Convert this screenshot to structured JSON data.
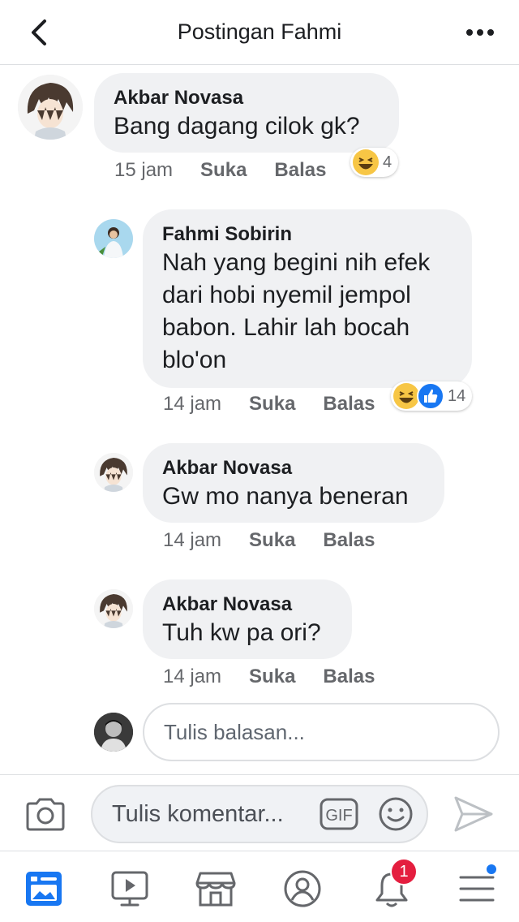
{
  "header": {
    "title": "Postingan Fahmi",
    "back_icon": "chevron-left-icon",
    "more_icon": "ellipsis-icon"
  },
  "comments": [
    {
      "author": "Akbar Novasa",
      "text": "Bang dagang cilok gk?",
      "time": "15 jam",
      "like": "Suka",
      "reply": "Balas",
      "reaction_count": "4",
      "reactions": [
        "haha"
      ]
    },
    {
      "author": "Fahmi Sobirin",
      "text_lines": [
        "Nah yang begini nih efek",
        "dari hobi nyemil jempol",
        "babon. Lahir lah bocah",
        "blo'on"
      ],
      "time": "14 jam",
      "like": "Suka",
      "reply": "Balas",
      "reaction_count": "14",
      "reactions": [
        "haha",
        "like"
      ]
    },
    {
      "author": "Akbar Novasa",
      "text": "Gw mo nanya beneran",
      "time": "14 jam",
      "like": "Suka",
      "reply": "Balas"
    },
    {
      "author": "Akbar Novasa",
      "text": "Tuh kw pa ori?",
      "time": "14 jam",
      "like": "Suka",
      "reply": "Balas"
    }
  ],
  "reply_input": {
    "placeholder": "Tulis balasan..."
  },
  "composer": {
    "placeholder": "Tulis komentar...",
    "gif_label": "GIF"
  },
  "tabbar": {
    "tabs": [
      "news-feed-icon",
      "watch-icon",
      "marketplace-icon",
      "profile-icon",
      "notifications-icon",
      "menu-icon"
    ],
    "notifications_badge": "1"
  },
  "colors": {
    "accent": "#1877f2",
    "badge": "#e41e3f",
    "bubble": "#f0f1f3",
    "secondary_text": "#65676b"
  }
}
